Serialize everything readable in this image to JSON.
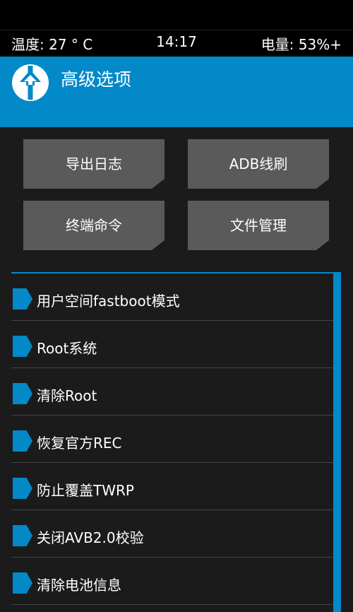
{
  "status": {
    "temperature": "温度: 27 ° C",
    "time": "14:17",
    "battery": "电量: 53%+"
  },
  "header": {
    "title": "高级选项"
  },
  "buttons": [
    {
      "label": "导出日志"
    },
    {
      "label": "ADB线刷"
    },
    {
      "label": "终端命令"
    },
    {
      "label": "文件管理"
    }
  ],
  "list": {
    "items": [
      {
        "label": "用户空间fastboot模式"
      },
      {
        "label": "Root系统"
      },
      {
        "label": "清除Root"
      },
      {
        "label": "恢复官方REC"
      },
      {
        "label": "防止覆盖TWRP"
      },
      {
        "label": "关闭AVB2.0校验"
      },
      {
        "label": "清除电池信息"
      }
    ]
  },
  "colors": {
    "accent": "#0388c8",
    "background": "#1b1b1b",
    "button": "#5a5a5a",
    "statusbar": "#000000"
  },
  "icons": {
    "logo": "twrp-logo-icon",
    "list_item": "flag-arrow-icon"
  }
}
